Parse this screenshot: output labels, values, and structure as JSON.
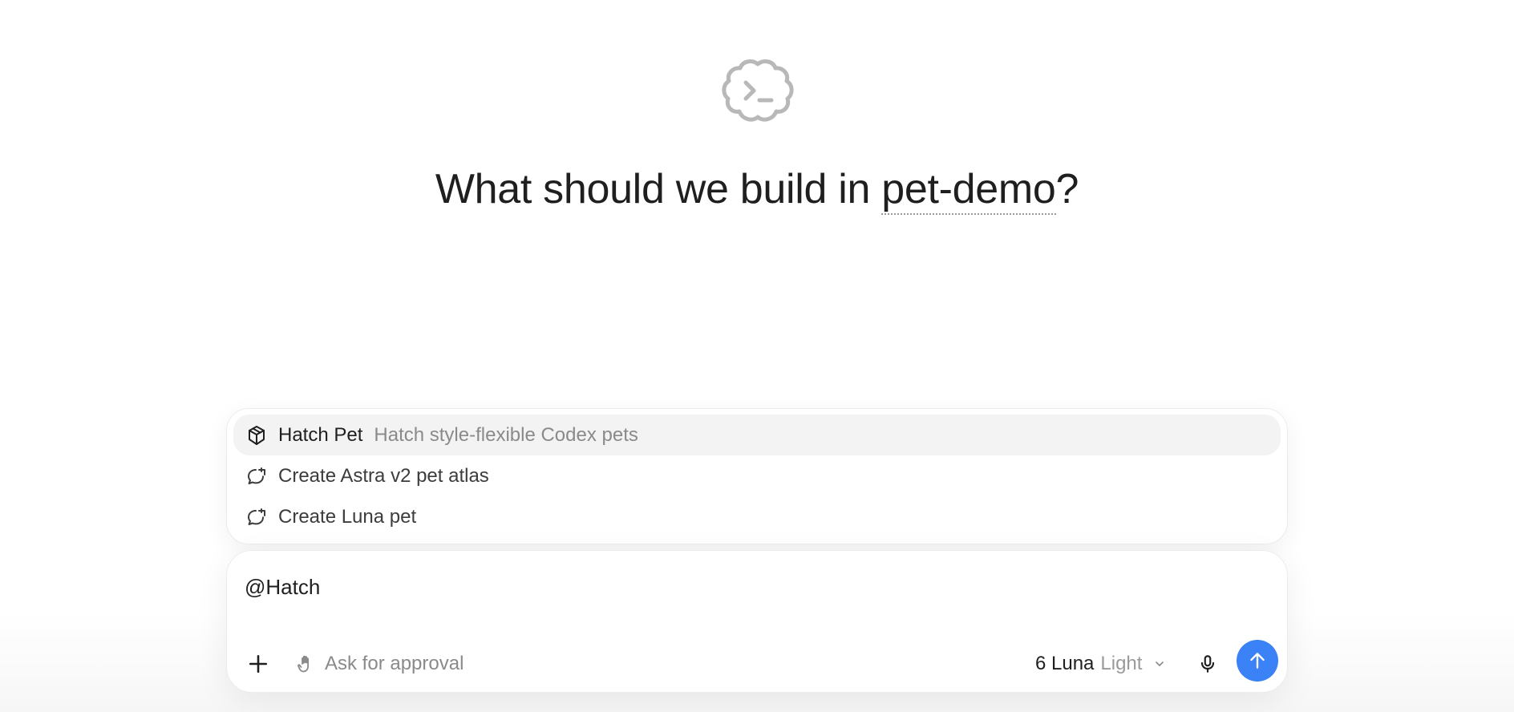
{
  "headline": {
    "prefix": "What should we build in ",
    "project": "pet-demo",
    "suffix": "?"
  },
  "suggestions": [
    {
      "icon": "cube-icon",
      "label": "Hatch Pet",
      "description": "Hatch style-flexible Codex pets",
      "active": true
    },
    {
      "icon": "chat-bubble-icon",
      "label": "Create Astra v2 pet atlas",
      "description": "",
      "active": false
    },
    {
      "icon": "chat-bubble-icon",
      "label": "Create Luna pet",
      "description": "",
      "active": false
    }
  ],
  "composer": {
    "input_value": "@Hatch",
    "approval_label": "Ask for approval",
    "model_name": "6 Luna",
    "model_variant": "Light"
  },
  "colors": {
    "accent": "#3b82f6",
    "muted_text": "#8a8a8a",
    "highlight_row": "#f3f3f3"
  }
}
